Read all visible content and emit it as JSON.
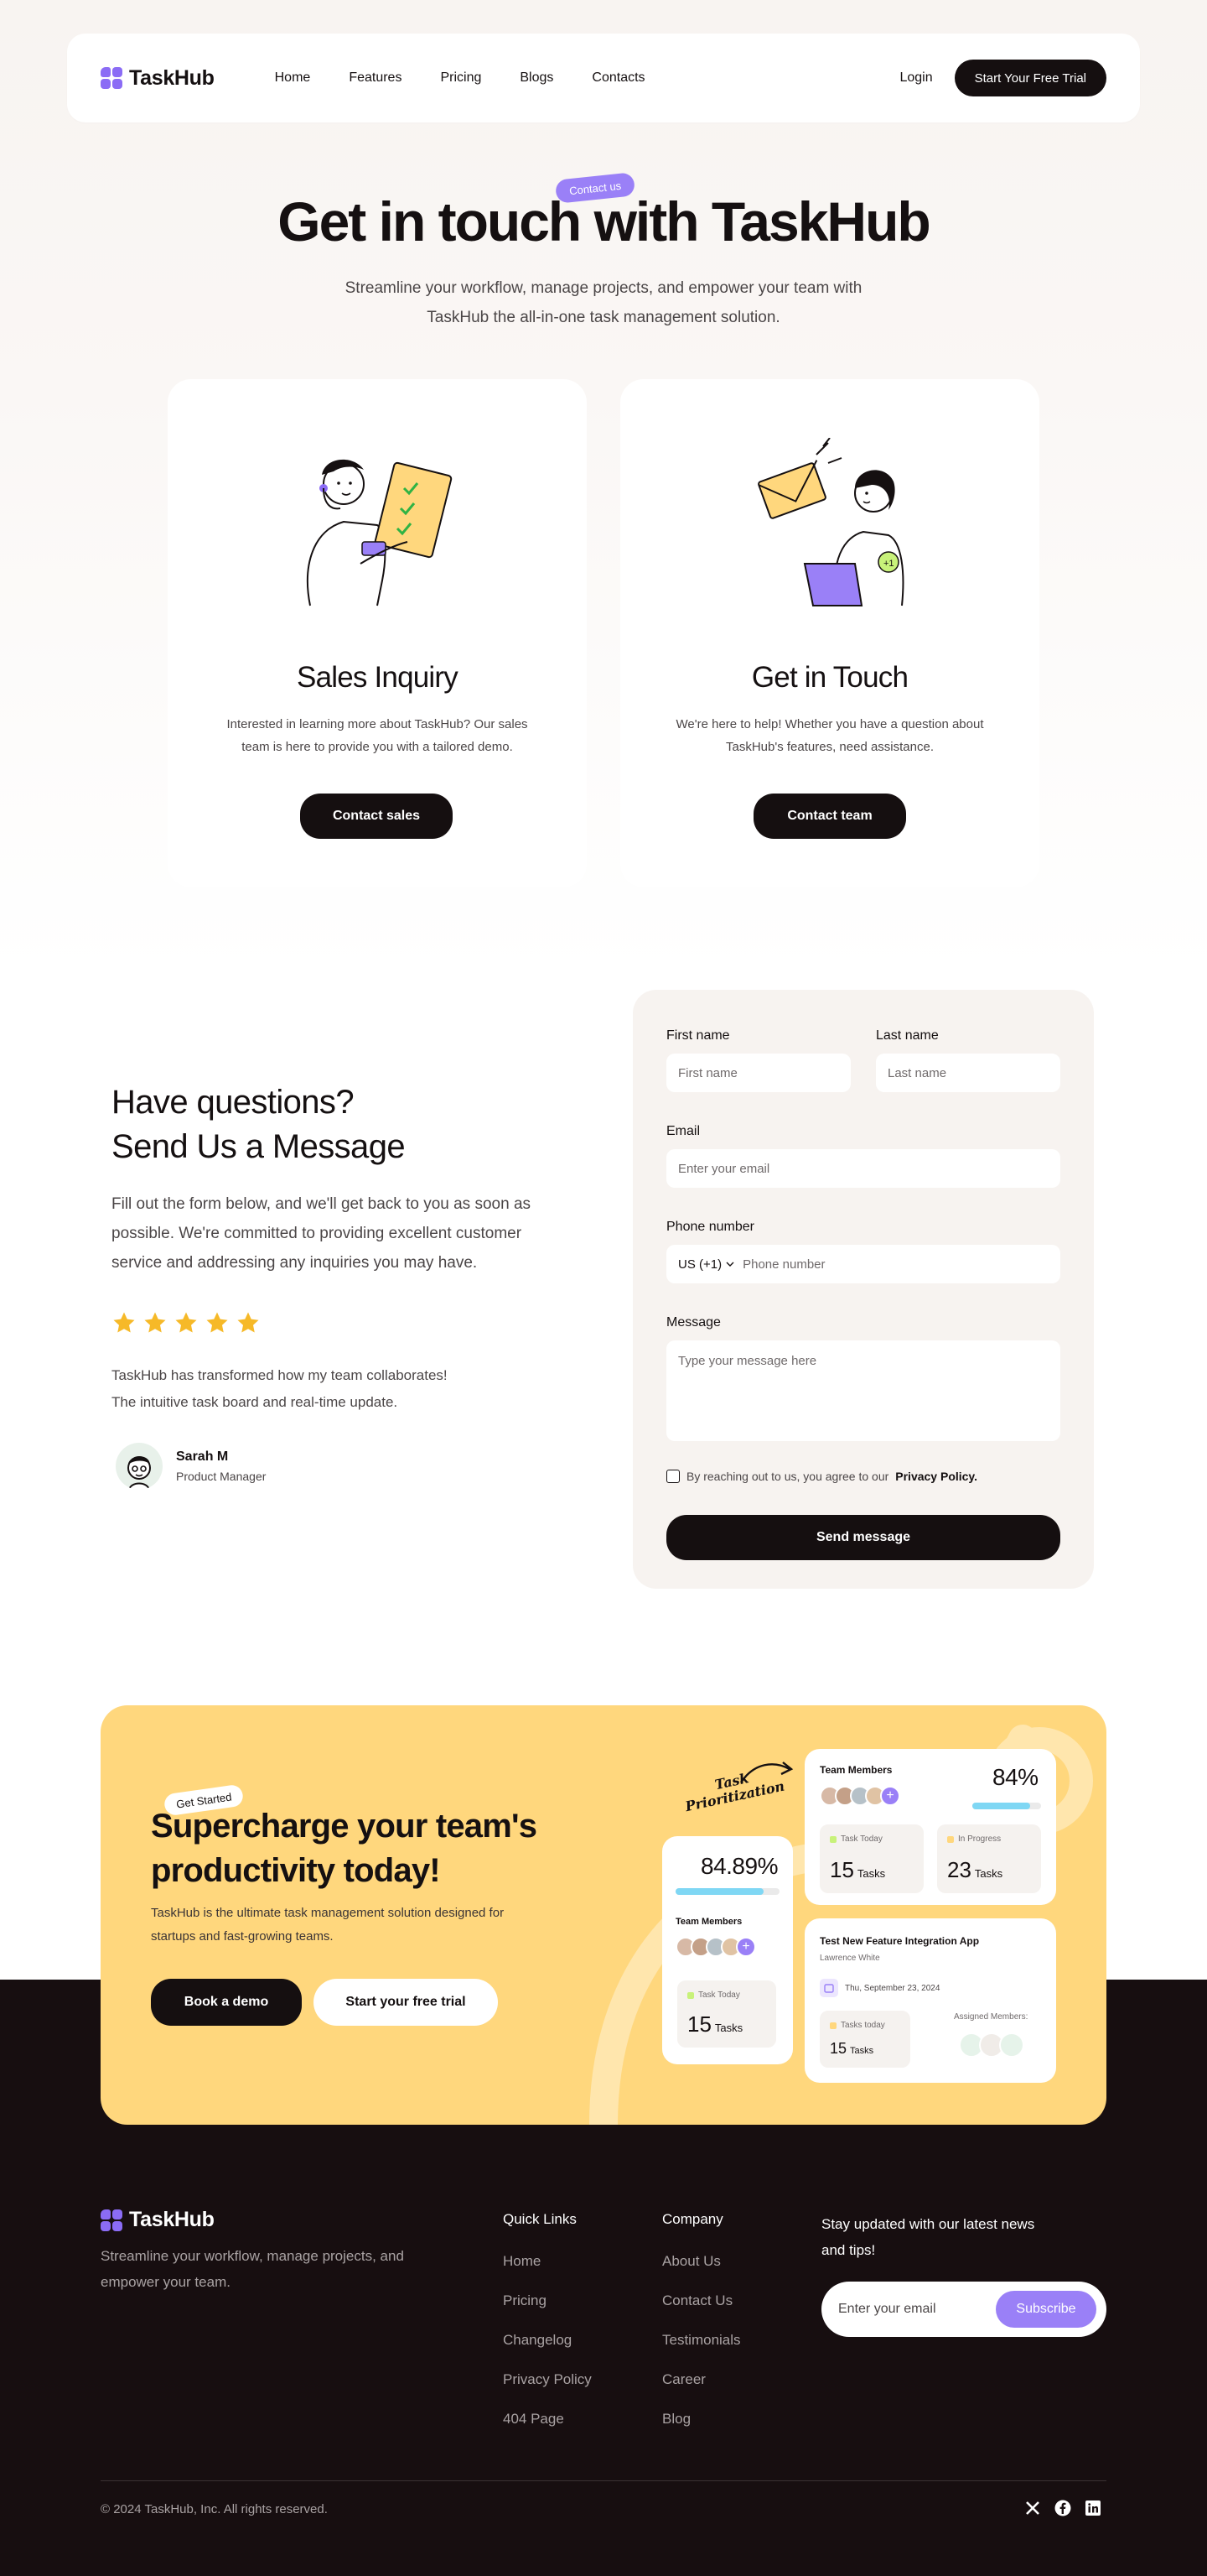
{
  "nav": {
    "logo": "TaskHub",
    "links": [
      "Home",
      "Features",
      "Pricing",
      "Blogs",
      "Contacts"
    ],
    "login": "Login",
    "cta": "Start Your Free Trial"
  },
  "hero": {
    "pill": "Contact us",
    "title": "Get in touch with TaskHub",
    "subtitle": "Streamline your workflow, manage projects, and empower your team with TaskHub the all-in-one task management solution."
  },
  "cards": [
    {
      "title": "Sales Inquiry",
      "description": "Interested in learning more about TaskHub? Our sales team is here to provide you with a tailored demo.",
      "button": "Contact sales"
    },
    {
      "title": "Get in Touch",
      "description": "We're here to help! Whether you have a question about TaskHub's features, need assistance.",
      "button": "Contact team"
    }
  ],
  "message": {
    "title_line1": "Have questions?",
    "title_line2": "Send Us a Message",
    "description": "Fill out the form below, and we'll get back to you as soon as possible. We're committed to providing excellent customer service and addressing any inquiries you may have.",
    "rating": 5,
    "quote_line1": "TaskHub has transformed how my team collaborates!",
    "quote_line2": "The intuitive task board and real-time update.",
    "person_name": "Sarah M",
    "person_role": "Product Manager"
  },
  "form": {
    "first_name_label": "First name",
    "first_name_placeholder": "First name",
    "last_name_label": "Last name",
    "last_name_placeholder": "Last name",
    "email_label": "Email",
    "email_placeholder": "Enter your email",
    "phone_label": "Phone number",
    "phone_country": "US (+1)",
    "phone_placeholder": "Phone number",
    "message_label": "Message",
    "message_placeholder": "Type your message here",
    "agree_text": "By reaching out to us, you agree to our",
    "agree_link": "Privacy Policy.",
    "submit": "Send message"
  },
  "cta": {
    "pill": "Get Started",
    "title_line1": "Supercharge your team's",
    "title_line2": "productivity today!",
    "description": "TaskHub is the ultimate task management solution designed for startups and fast-growing teams.",
    "button_primary": "Book a demo",
    "button_secondary": "Start your free trial",
    "task_label_line1": "Task",
    "task_label_line2": "Prioritization",
    "card_left": {
      "percent": "84.89%",
      "progress": 0.8489,
      "members_title": "Team Members",
      "stat_label": "Task Today",
      "stat_number": "15",
      "stat_unit": "Tasks"
    },
    "card_top": {
      "title": "Team Members",
      "percent": "84%",
      "progress": 0.84,
      "stat1_label": "Task Today",
      "stat1_number": "15",
      "stat1_unit": "Tasks",
      "stat2_label": "In Progress",
      "stat2_number": "23",
      "stat2_unit": "Tasks"
    },
    "card_bottom": {
      "title": "Test New Feature Integration App",
      "assignee": "Lawrence White",
      "date": "Thu, September 23, 2024",
      "stat_label": "Tasks today",
      "stat_number": "15",
      "stat_unit": "Tasks",
      "assigned_label": "Assigned Members:"
    },
    "colors": {
      "accent_purple": "#9a80f7",
      "band_yellow": "#ffd77d",
      "progress_blue": "#7fd7f4"
    }
  },
  "footer": {
    "logo": "TaskHub",
    "description": "Streamline your workflow, manage projects, and empower your team.",
    "quick_links_title": "Quick Links",
    "quick_links": [
      "Home",
      "Pricing",
      "Changelog",
      "Privacy Policy",
      "404 Page"
    ],
    "company_title": "Company",
    "company_links": [
      "About Us",
      "Contact Us",
      "Testimonials",
      "Career",
      "Blog"
    ],
    "newsletter_text": "Stay updated with our latest news and tips!",
    "email_placeholder": "Enter your email",
    "subscribe": "Subscribe",
    "copyright": "© 2024 TaskHub, Inc. All rights reserved.",
    "social_icons": [
      "x-icon",
      "facebook-icon",
      "linkedin-icon"
    ]
  }
}
